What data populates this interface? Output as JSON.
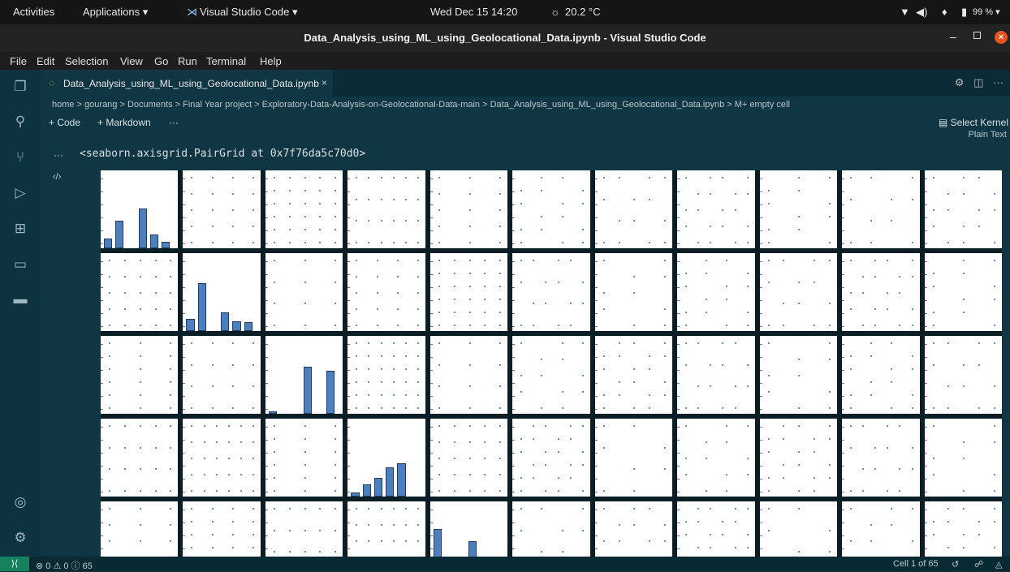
{
  "topbar": {
    "activities": "Activities",
    "applications": "Applications ▾",
    "app_name": "Visual Studio Code ▾",
    "datetime": "Wed Dec 15  14:20",
    "weather": "20.2 °C",
    "battery": "99 % ▾"
  },
  "window": {
    "title": "Data_Analysis_using_ML_using_Geolocational_Data.ipynb - Visual Studio Code"
  },
  "menu": [
    "File",
    "Edit",
    "Selection",
    "View",
    "Go",
    "Run",
    "Terminal",
    "Help"
  ],
  "tab": {
    "label": "Data_Analysis_using_ML_using_Geolocational_Data.ipynb"
  },
  "breadcrumb": "home > gourang > Documents > Final Year project > Exploratory-Data-Analysis-on-Geolocational-Data-main > Data_Analysis_using_ML_using_Geolocational_Data.ipynb > M+ empty cell",
  "notebook_toolbar": {
    "code": "+ Code",
    "markdown": "+ Markdown",
    "more": "···",
    "kernel": "Select Kernel"
  },
  "output": {
    "renderer": "Plain Text",
    "dots": "···",
    "text": "<seaborn.axisgrid.PairGrid at 0x7f76da5c70d0>"
  },
  "statusbar": {
    "problems": "⊗ 0 ⚠ 0 ⓘ 65",
    "cell": "Cell 1 of 65"
  },
  "colors": {
    "bar": "#4c7fbf",
    "point": "#3a6aa8",
    "editor_bg": "#0f3642"
  },
  "pairgrid": {
    "cols": 11,
    "rows": 5,
    "diag_hist": [
      [
        0.12,
        0.35,
        0,
        0.51,
        0.18,
        0.08
      ],
      [
        0.16,
        0.61,
        0,
        0.24,
        0.12,
        0.11
      ],
      [
        0.03,
        0,
        0,
        0.6,
        0,
        0.55
      ],
      [
        0.05,
        0.16,
        0.24,
        0.38,
        0.43,
        0
      ],
      [
        0.4,
        0,
        0,
        0.24,
        0,
        0
      ]
    ]
  }
}
